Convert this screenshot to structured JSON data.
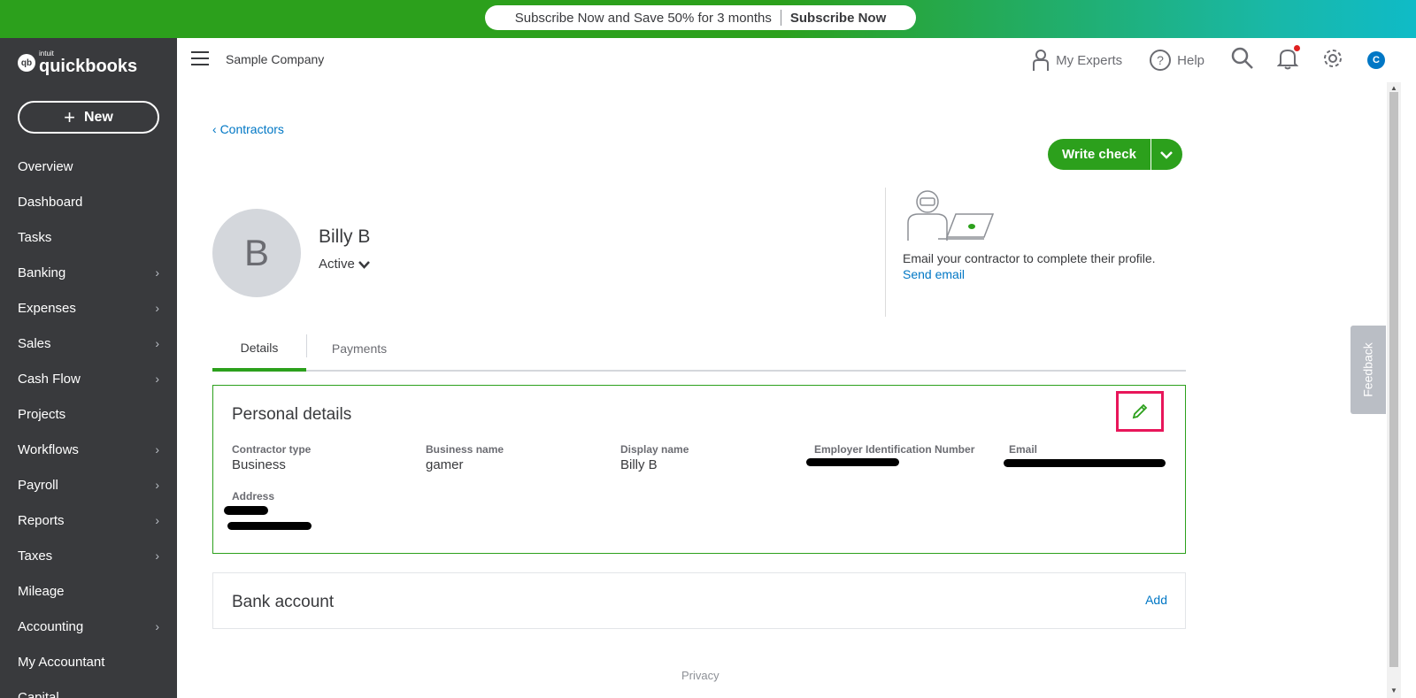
{
  "promo": {
    "text": "Subscribe Now and Save 50% for 3 months",
    "cta": "Subscribe Now"
  },
  "sidebar": {
    "logo_small": "intuit",
    "logo_big": "quickbooks",
    "logo_badge": "qb",
    "new_label": "New",
    "items": [
      {
        "label": "Overview",
        "chevron": false
      },
      {
        "label": "Dashboard",
        "chevron": false
      },
      {
        "label": "Tasks",
        "chevron": false
      },
      {
        "label": "Banking",
        "chevron": true
      },
      {
        "label": "Expenses",
        "chevron": true
      },
      {
        "label": "Sales",
        "chevron": true
      },
      {
        "label": "Cash Flow",
        "chevron": true
      },
      {
        "label": "Projects",
        "chevron": false
      },
      {
        "label": "Workflows",
        "chevron": true
      },
      {
        "label": "Payroll",
        "chevron": true
      },
      {
        "label": "Reports",
        "chevron": true
      },
      {
        "label": "Taxes",
        "chevron": true
      },
      {
        "label": "Mileage",
        "chevron": false
      },
      {
        "label": "Accounting",
        "chevron": true
      },
      {
        "label": "My Accountant",
        "chevron": false
      },
      {
        "label": "Capital",
        "chevron": false
      }
    ]
  },
  "header": {
    "company": "Sample Company",
    "my_experts": "My Experts",
    "help": "Help",
    "avatar_initial": "C"
  },
  "main": {
    "breadcrumb": "Contractors",
    "write_check": "Write check",
    "avatar_initial": "B",
    "name": "Billy B",
    "status": "Active",
    "promo_text": "Email your contractor to complete their profile.",
    "send_email": "Send email",
    "tabs": [
      "Details",
      "Payments"
    ],
    "personal": {
      "title": "Personal details",
      "fields": [
        {
          "label": "Contractor type",
          "value": "Business"
        },
        {
          "label": "Business name",
          "value": "gamer"
        },
        {
          "label": "Display name",
          "value": "Billy B"
        },
        {
          "label": "Employer Identification Number",
          "value": ""
        },
        {
          "label": "Email",
          "value": ""
        }
      ],
      "address_label": "Address"
    },
    "bank": {
      "title": "Bank account",
      "add": "Add"
    },
    "privacy": "Privacy",
    "feedback": "Feedback"
  },
  "colors": {
    "green": "#2ca01c",
    "sidebar_bg": "#393a3d",
    "link_blue": "#0077c5",
    "highlight": "#e8165a"
  }
}
